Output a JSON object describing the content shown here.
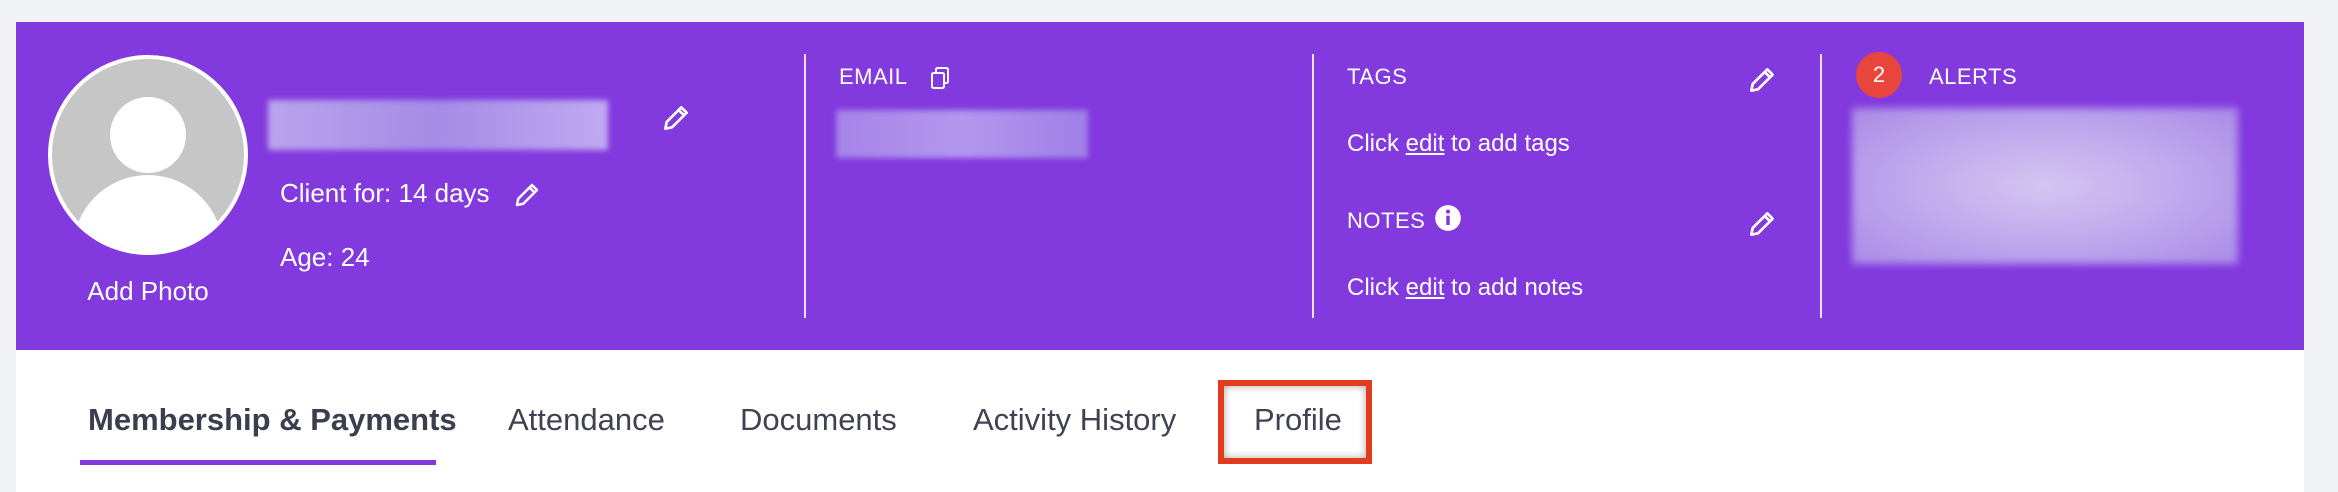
{
  "profile": {
    "add_photo": "Add Photo",
    "client_for": "Client for: 14 days",
    "age": "Age: 24"
  },
  "email": {
    "label": "EMAIL"
  },
  "tags": {
    "label": "TAGS",
    "hint_before": "Click ",
    "hint_link": "edit",
    "hint_after": " to add tags"
  },
  "notes": {
    "label": "NOTES",
    "hint_before": "Click ",
    "hint_link": "edit",
    "hint_after": " to add notes"
  },
  "alerts": {
    "count": "2",
    "label": "ALERTS"
  },
  "tabs": [
    {
      "label": "Membership & Payments",
      "active": true
    },
    {
      "label": "Attendance"
    },
    {
      "label": "Documents"
    },
    {
      "label": "Activity History"
    },
    {
      "label": "Profile",
      "highlighted": true
    }
  ],
  "colors": {
    "header_bg": "#8239de",
    "alert_badge": "#e8453c",
    "highlight_border": "#e23b1f",
    "tab_underline": "#8239de"
  },
  "icons": [
    "pencil-icon",
    "copy-icon",
    "info-icon"
  ]
}
